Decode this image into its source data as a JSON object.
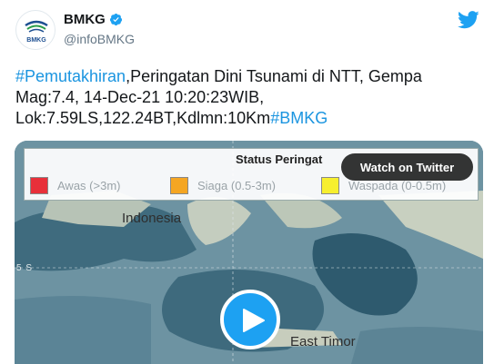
{
  "account": {
    "display_name": "BMKG",
    "handle": "@infoBMKG",
    "avatar_text": "BMKG"
  },
  "tweet": {
    "hashtag": "#Pemutakhiran",
    "text_part1": ",Peringatan Dini Tsunami di NTT, Gempa Mag:7.4, 14-Dec-21 10:20:23WIB, Lok:7.59LS,122.24BT,Kdlmn:10Km",
    "trailing_hashtag": "#BMKG"
  },
  "media": {
    "legend_title": "Status Peringat",
    "legend_items": [
      {
        "label": "Awas (>3m)",
        "color": "#e8303a"
      },
      {
        "label": "Siaga (0.5-3m)",
        "color": "#f5a623"
      },
      {
        "label": "Waspada (0-0.5m)",
        "color": "#f7ef2e"
      }
    ],
    "watch_label": "Watch on Twitter",
    "map_label_indonesia": "Indonesia",
    "map_label_timor": "East Timor",
    "coord_label": "5 S"
  },
  "colors": {
    "accent": "#1da1f2",
    "hashtag": "#1b95e0",
    "secondary_text": "#657786"
  },
  "icons": {
    "verified": "verified-badge-icon",
    "brand": "twitter-bird-icon",
    "play": "play-icon"
  }
}
